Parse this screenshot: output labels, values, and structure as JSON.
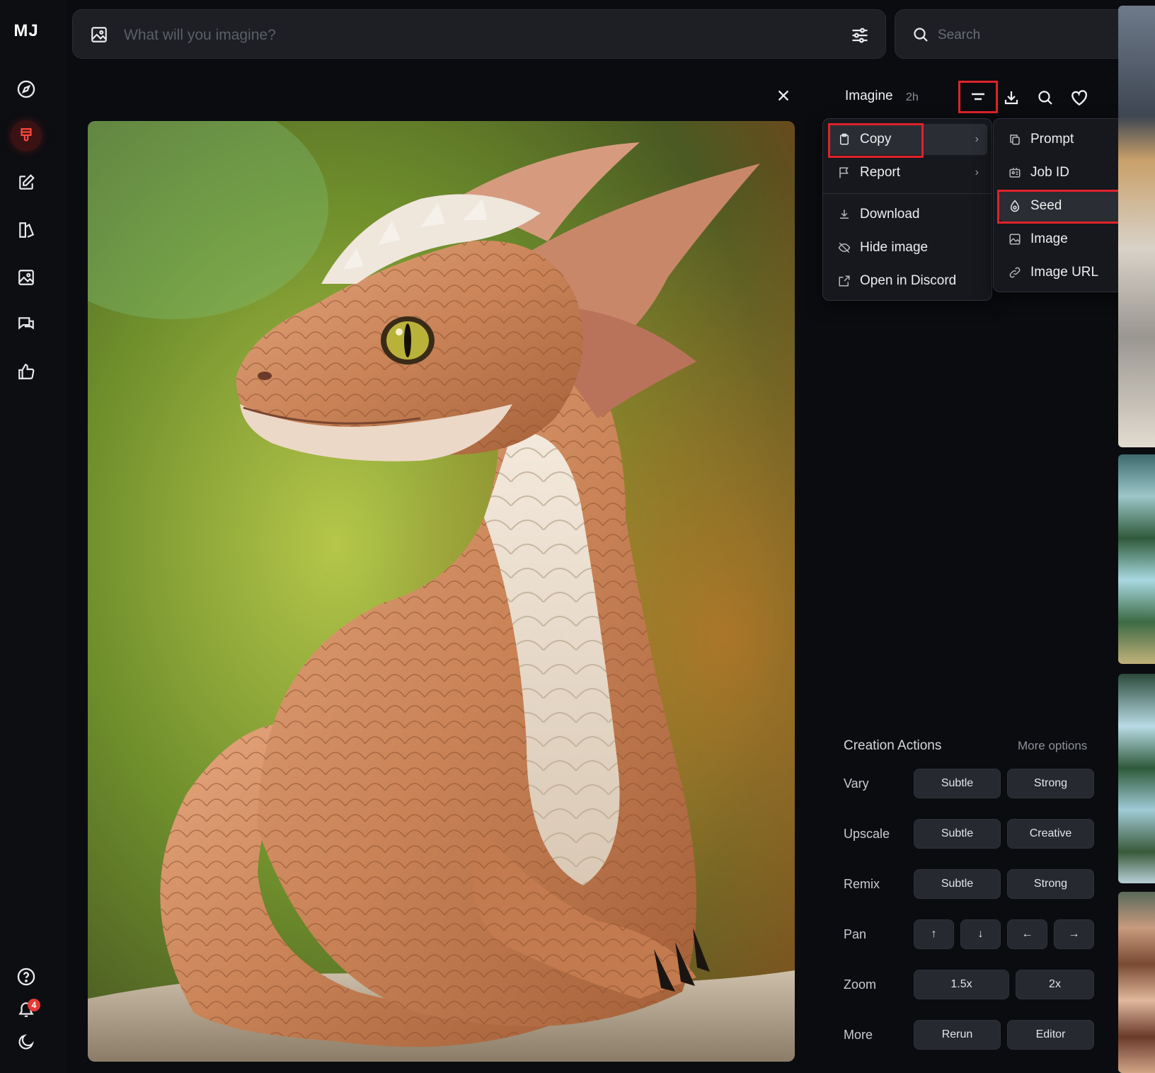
{
  "app": {
    "logo": "MJ",
    "notifications_count": "4"
  },
  "prompt_bar": {
    "placeholder": "What will you imagine?"
  },
  "search": {
    "placeholder": "Search"
  },
  "nav_icons": [
    "explore-icon",
    "create-brush-icon",
    "edit-icon",
    "organize-icon",
    "gallery-icon",
    "chat-icon",
    "like-icon",
    "help-icon",
    "notifications-icon",
    "theme-moon-icon"
  ],
  "detail": {
    "title": "Imagine",
    "time": "2h"
  },
  "main_menu": {
    "copy": "Copy",
    "report": "Report",
    "download": "Download",
    "hide_image": "Hide image",
    "open_discord": "Open in Discord"
  },
  "copy_submenu": {
    "prompt": "Prompt",
    "job_id": "Job ID",
    "seed": "Seed",
    "image": "Image",
    "image_url": "Image URL"
  },
  "creation_actions": {
    "title": "Creation Actions",
    "more_options": "More options",
    "vary": {
      "label": "Vary",
      "b1": "Subtle",
      "b2": "Strong"
    },
    "upscale": {
      "label": "Upscale",
      "b1": "Subtle",
      "b2": "Creative"
    },
    "remix": {
      "label": "Remix",
      "b1": "Subtle",
      "b2": "Strong"
    },
    "pan": {
      "label": "Pan",
      "up": "↑",
      "down": "↓",
      "left": "←",
      "right": "→"
    },
    "zoom": {
      "label": "Zoom",
      "b1": "1.5x",
      "b2": "2x"
    },
    "more": {
      "label": "More",
      "b1": "Rerun",
      "b2": "Editor"
    }
  },
  "colors": {
    "accent_red": "#e0222a",
    "panel_bg": "#0b0c10",
    "button_bg": "#262930"
  }
}
